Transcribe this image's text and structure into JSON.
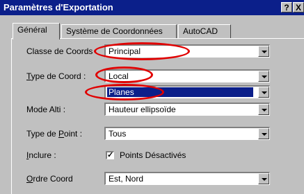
{
  "window": {
    "title": "Paramètres d'Exportation",
    "help_label": "?",
    "close_label": "X"
  },
  "tabs": [
    {
      "label": "Général"
    },
    {
      "label": "Système de Coordonnées"
    },
    {
      "label": "AutoCAD"
    }
  ],
  "form": {
    "classe_label": "Classe de Coords",
    "classe_value": "Principal",
    "type_coord_label": "Type de Coord :",
    "type_coord_value": "Local",
    "type_coord2_value": "Planes",
    "mode_alti_label": "Mode Alti :",
    "mode_alti_value": "Hauteur ellipsoïde",
    "type_point_label": "Type de Point :",
    "type_point_value": "Tous",
    "inclure_label": "Inclure :",
    "points_desactives_label": "Points Désactivés",
    "points_desactives_checked": true,
    "ordre_label": "Ordre Coord",
    "ordre_value": "Est, Nord"
  },
  "colors": {
    "titlebar": "#0b1f8a",
    "selection": "#0b1f8a",
    "annotation": "#e00000"
  }
}
